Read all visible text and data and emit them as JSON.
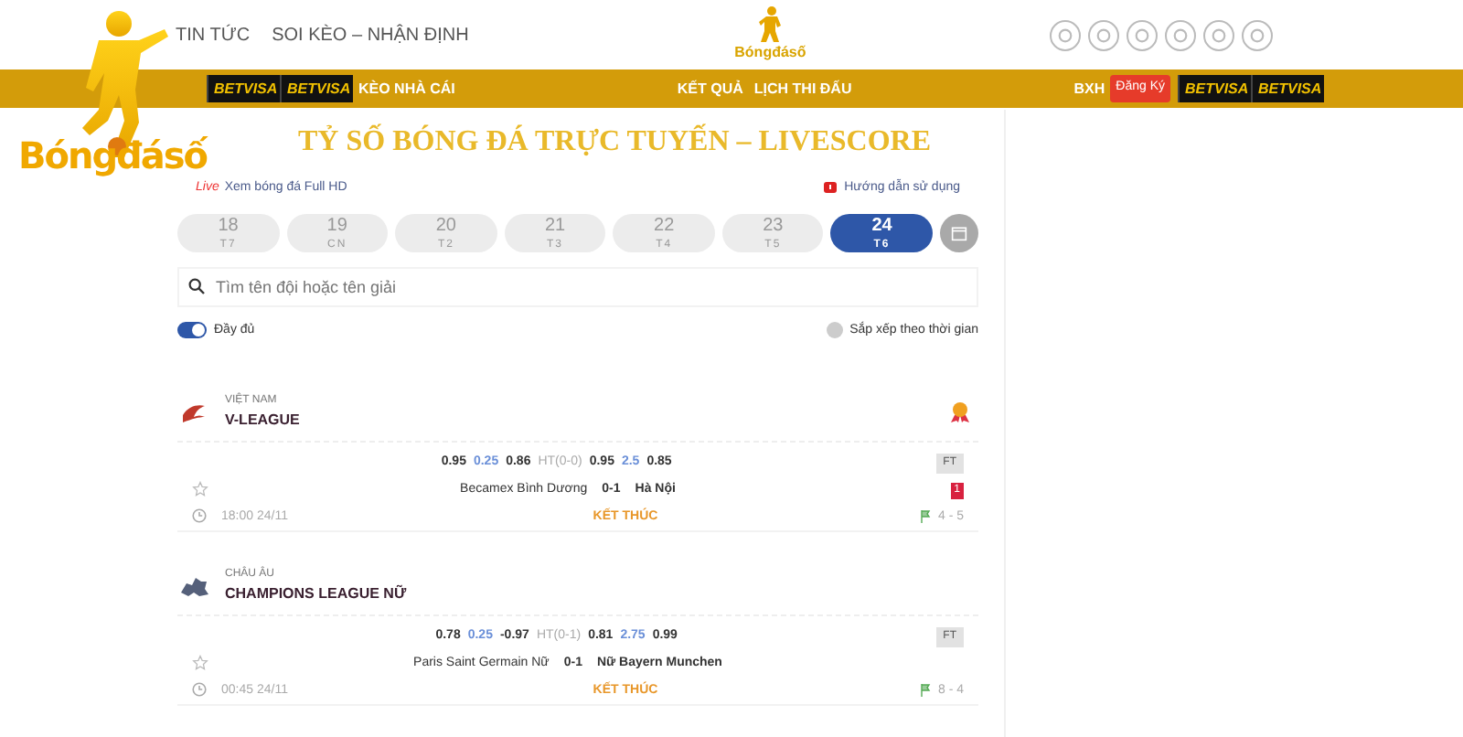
{
  "header": {
    "links": [
      "TIN TỨC",
      "SOI KÈO – NHẬN ĐỊNH"
    ],
    "logo": "Bóngđásố"
  },
  "navbar": [
    {
      "kind": "banner",
      "text": "BETVISA"
    },
    {
      "kind": "banner",
      "text": "BETVISA"
    },
    {
      "kind": "link",
      "text": "KÈO NHÀ CÁI"
    },
    {
      "kind": "gap"
    },
    {
      "kind": "link",
      "text": "KẾT QUẢ"
    },
    {
      "kind": "link",
      "text": "LỊCH THI ĐẤU"
    },
    {
      "kind": "gap"
    },
    {
      "kind": "link",
      "text": "BXH"
    },
    {
      "kind": "button",
      "text": "Đăng Ký"
    },
    {
      "kind": "banner",
      "text": "BETVISA"
    },
    {
      "kind": "banner",
      "text": "BETVISA"
    }
  ],
  "floating_logo": "Bóngđásố",
  "title": "TỶ SỐ BÓNG ĐÁ TRỰC TUYẾN – LIVESCORE",
  "live_link": {
    "badge": "Live",
    "text": "Xem bóng đá Full HD"
  },
  "guide_link": "Hướng dẫn sử dụng",
  "dates": [
    {
      "day": "18",
      "weekday": "T7",
      "selected": false
    },
    {
      "day": "19",
      "weekday": "CN",
      "selected": false
    },
    {
      "day": "20",
      "weekday": "T2",
      "selected": false
    },
    {
      "day": "21",
      "weekday": "T3",
      "selected": false
    },
    {
      "day": "22",
      "weekday": "T4",
      "selected": false
    },
    {
      "day": "23",
      "weekday": "T5",
      "selected": false
    },
    {
      "day": "24",
      "weekday": "T6",
      "selected": true
    }
  ],
  "search": {
    "placeholder": "Tìm tên đội hoặc tên giải"
  },
  "full_toggle": {
    "label": "Đầy đủ",
    "on": true
  },
  "sort_by_time": {
    "label": "Sắp xếp theo thời gian",
    "checked": false
  },
  "leagues": [
    {
      "country": "VIỆT NAM",
      "name": "V-LEAGUE",
      "featured": true,
      "matches": [
        {
          "odds": [
            "0.95",
            "0.25",
            "0.86"
          ],
          "ht": "HT(0-0)",
          "totals": [
            "0.95",
            "2.5",
            "0.85"
          ],
          "tag": "FT",
          "home": "Becamex Bình Dương",
          "score": "0-1",
          "away": "Hà Nội",
          "red_cards": "1",
          "time": "18:00 24/11",
          "status": "KẾT THÚC",
          "corners": "4 - 5"
        }
      ]
    },
    {
      "country": "CHÂU ÂU",
      "name": "CHAMPIONS LEAGUE NỮ",
      "featured": false,
      "matches": [
        {
          "odds": [
            "0.78",
            "0.25",
            "-0.97"
          ],
          "ht": "HT(0-1)",
          "totals": [
            "0.81",
            "2.75",
            "0.99"
          ],
          "tag": "FT",
          "home": "Paris Saint Germain Nữ",
          "score": "0-1",
          "away": "Nữ Bayern Munchen",
          "time": "00:45 24/11",
          "status": "KẾT THÚC",
          "corners": "8 - 4"
        }
      ]
    }
  ]
}
